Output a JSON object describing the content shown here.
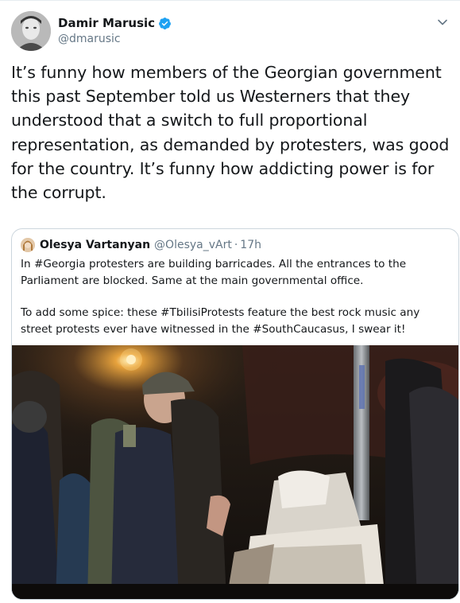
{
  "tweet": {
    "author_name": "Damir Marusic",
    "author_handle": "@dmarusic",
    "text": "It’s funny how members of the Georgian government this past September told us Westerners that they understood that a switch to full proportional representation, as demanded by protesters, was good for the country. It’s funny how addicting power is for the corrupt."
  },
  "quoted": {
    "name": "Olesya Vartanyan",
    "handle": "@Olesya_vArt",
    "separator": "·",
    "time": "17h",
    "paragraph1": "In #Georgia protesters are building barricades. All the entrances to the Parliament are blocked. Same at the main governmental office.",
    "paragraph2": "To add some spice: these #TbilisiProtests feature the best rock music any street protests ever have witnessed in the #SouthCaucasus, I swear it!"
  },
  "icons": {
    "verified": "verified-badge-icon",
    "caret": "chevron-down-icon"
  },
  "colors": {
    "text": "#14171a",
    "secondary": "#657786",
    "verified": "#1da1f2",
    "border": "#ccd6dd"
  }
}
